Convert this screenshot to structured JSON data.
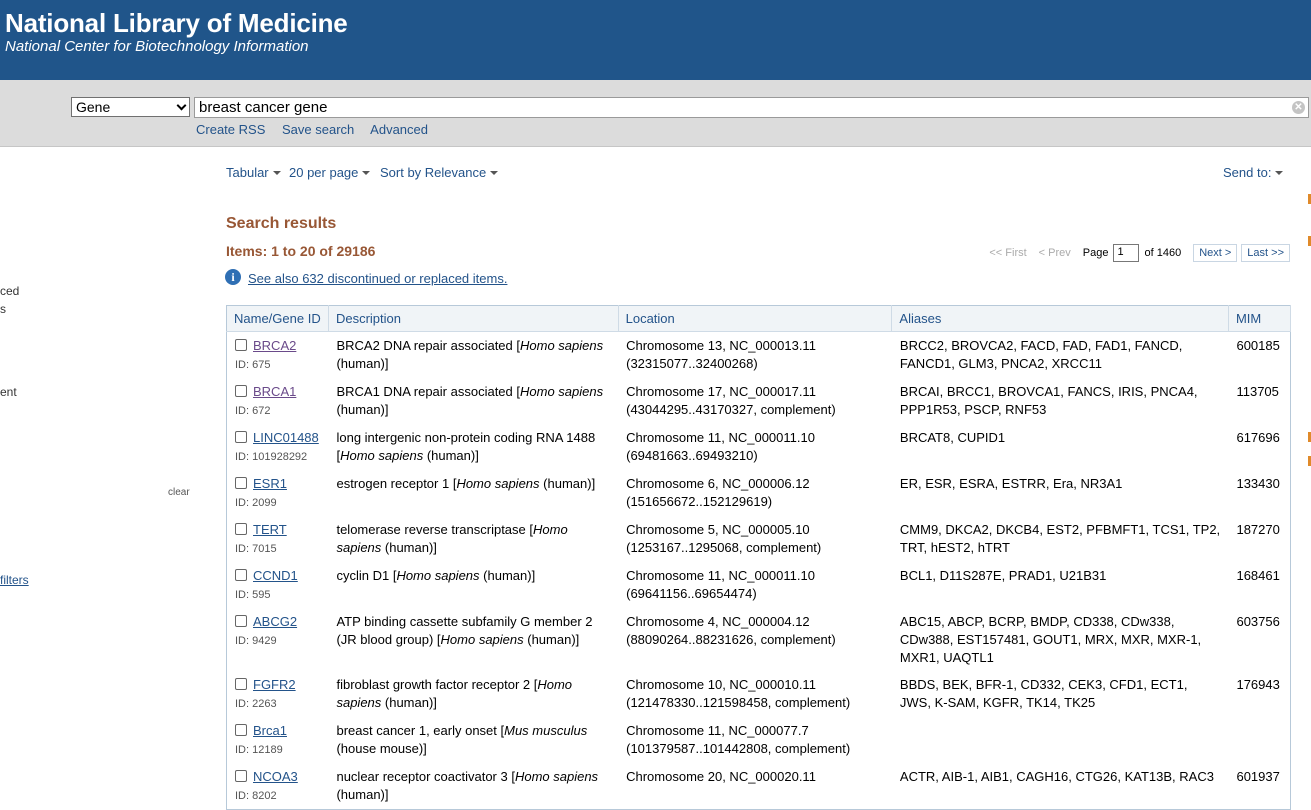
{
  "header": {
    "org": "National Library of Medicine",
    "sub": "National Center for Biotechnology Information"
  },
  "search": {
    "database": "Gene",
    "query": "breast cancer gene",
    "links": [
      "Create RSS",
      "Save search",
      "Advanced"
    ]
  },
  "sidebar": {
    "fragments": [
      "ced",
      "s",
      "ent",
      "clear"
    ],
    "filters_link": "filters"
  },
  "display": {
    "format": "Tabular",
    "per_page": "20 per page",
    "sort": "Sort by Relevance",
    "send_to": "Send to:"
  },
  "results": {
    "title": "Search results",
    "items": "Items: 1 to 20 of 29186",
    "see_also": "See also 632 discontinued or replaced items."
  },
  "pager": {
    "first": "<< First",
    "prev": "< Prev",
    "page_label": "Page",
    "page_value": "1",
    "of": "of 1460",
    "next": "Next >",
    "last": "Last >>"
  },
  "table": {
    "headers": [
      "Name/Gene ID",
      "Description",
      "Location",
      "Aliases",
      "MIM"
    ],
    "rows": [
      {
        "name": "BRCA2",
        "id": "ID: 675",
        "desc_a": "BRCA2 DNA repair associated [",
        "species": "Homo sapiens",
        "desc_b": " (human)]",
        "loc1": "Chromosome 13, NC_000013.11",
        "loc2": "(32315077..32400268)",
        "aliases": "BRCC2, BROVCA2, FACD, FAD, FAD1, FANCD, FANCD1, GLM3, PNCA2, XRCC11",
        "mim": "600185",
        "visited": true
      },
      {
        "name": "BRCA1",
        "id": "ID: 672",
        "desc_a": "BRCA1 DNA repair associated [",
        "species": "Homo sapiens",
        "desc_b": " (human)]",
        "loc1": "Chromosome 17, NC_000017.11",
        "loc2": "(43044295..43170327, complement)",
        "aliases": "BRCAI, BRCC1, BROVCA1, FANCS, IRIS, PNCA4, PPP1R53, PSCP, RNF53",
        "mim": "113705",
        "visited": true
      },
      {
        "name": "LINC01488",
        "id": "ID: 101928292",
        "desc_a": "long intergenic non-protein coding RNA 1488 [",
        "species": "Homo sapiens",
        "desc_b": " (human)]",
        "loc1": "Chromosome 11, NC_000011.10",
        "loc2": "(69481663..69493210)",
        "aliases": "BRCAT8, CUPID1",
        "mim": "617696",
        "visited": false
      },
      {
        "name": "ESR1",
        "id": "ID: 2099",
        "desc_a": "estrogen receptor 1 [",
        "species": "Homo sapiens",
        "desc_b": " (human)]",
        "loc1": "Chromosome 6, NC_000006.12",
        "loc2": "(151656672..152129619)",
        "aliases": "ER, ESR, ESRA, ESTRR, Era, NR3A1",
        "mim": "133430",
        "visited": false
      },
      {
        "name": "TERT",
        "id": "ID: 7015",
        "desc_a": "telomerase reverse transcriptase [",
        "species": "Homo sapiens",
        "desc_b": " (human)]",
        "loc1": "Chromosome 5, NC_000005.10",
        "loc2": "(1253167..1295068, complement)",
        "aliases": "CMM9, DKCA2, DKCB4, EST2, PFBMFT1, TCS1, TP2, TRT, hEST2, hTRT",
        "mim": "187270",
        "visited": false
      },
      {
        "name": "CCND1",
        "id": "ID: 595",
        "desc_a": "cyclin D1 [",
        "species": "Homo sapiens",
        "desc_b": " (human)]",
        "loc1": "Chromosome 11, NC_000011.10",
        "loc2": "(69641156..69654474)",
        "aliases": "BCL1, D11S287E, PRAD1, U21B31",
        "mim": "168461",
        "visited": false
      },
      {
        "name": "ABCG2",
        "id": "ID: 9429",
        "desc_a": "ATP binding cassette subfamily G member 2 (JR blood group) [",
        "species": "Homo sapiens",
        "desc_b": " (human)]",
        "loc1": "Chromosome 4, NC_000004.12",
        "loc2": "(88090264..88231626, complement)",
        "aliases": "ABC15, ABCP, BCRP, BMDP, CD338, CDw338, CDw388, EST157481, GOUT1, MRX, MXR, MXR-1, MXR1, UAQTL1",
        "mim": "603756",
        "visited": false
      },
      {
        "name": "FGFR2",
        "id": "ID: 2263",
        "desc_a": "fibroblast growth factor receptor 2 [",
        "species": "Homo sapiens",
        "desc_b": " (human)]",
        "loc1": "Chromosome 10, NC_000010.11",
        "loc2": "(121478330..121598458, complement)",
        "aliases": "BBDS, BEK, BFR-1, CD332, CEK3, CFD1, ECT1, JWS, K-SAM, KGFR, TK14, TK25",
        "mim": "176943",
        "visited": false
      },
      {
        "name": "Brca1",
        "id": "ID: 12189",
        "desc_a": "breast cancer 1, early onset [",
        "species": "Mus musculus",
        "desc_b": " (house mouse)]",
        "loc1": "Chromosome 11, NC_000077.7",
        "loc2": "(101379587..101442808, complement)",
        "aliases": "",
        "mim": "",
        "visited": false
      },
      {
        "name": "NCOA3",
        "id": "ID: 8202",
        "desc_a": "nuclear receptor coactivator 3 [",
        "species": "Homo sapiens",
        "desc_b": " (human)]",
        "loc1": "Chromosome 20, NC_000020.11",
        "loc2": "",
        "aliases": "ACTR, AIB-1, AIB1, CAGH16, CTG26, KAT13B, RAC3",
        "mim": "601937",
        "visited": false
      }
    ]
  }
}
